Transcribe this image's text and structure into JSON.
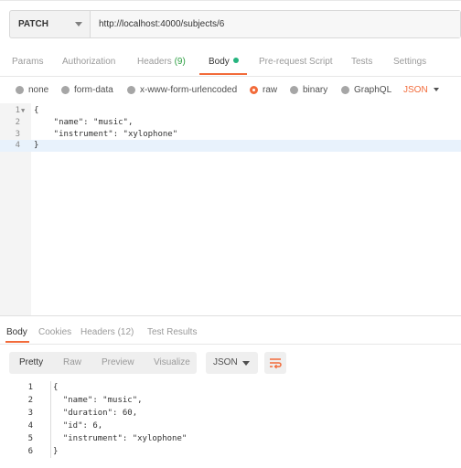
{
  "request": {
    "method": "PATCH",
    "url": "http://localhost:4000/subjects/6"
  },
  "request_tabs": [
    {
      "label": "Params",
      "count": "",
      "active": false
    },
    {
      "label": "Authorization",
      "count": "",
      "active": false
    },
    {
      "label": "Headers",
      "count": "(9)",
      "active": false
    },
    {
      "label": "Body",
      "count": "",
      "active": true
    },
    {
      "label": "Pre-request Script",
      "count": "",
      "active": false
    },
    {
      "label": "Tests",
      "count": "",
      "active": false
    },
    {
      "label": "Settings",
      "count": "",
      "active": false
    }
  ],
  "body_types": [
    {
      "label": "none",
      "selected": false
    },
    {
      "label": "form-data",
      "selected": false
    },
    {
      "label": "x-www-form-urlencoded",
      "selected": false
    },
    {
      "label": "raw",
      "selected": true
    },
    {
      "label": "binary",
      "selected": false
    },
    {
      "label": "GraphQL",
      "selected": false
    }
  ],
  "raw_format": "JSON",
  "request_body": {
    "line_numbers": [
      "1",
      "2",
      "3",
      "4"
    ],
    "lines": [
      "{",
      "    \"name\": \"music\",",
      "    \"instrument\": \"xylophone\"",
      "}"
    ]
  },
  "response_tabs": [
    {
      "label": "Body",
      "active": true
    },
    {
      "label": "Cookies",
      "active": false
    },
    {
      "label": "Headers (12)",
      "active": false
    },
    {
      "label": "Test Results",
      "active": false
    }
  ],
  "response_views": [
    {
      "label": "Pretty",
      "active": true
    },
    {
      "label": "Raw",
      "active": false
    },
    {
      "label": "Preview",
      "active": false
    },
    {
      "label": "Visualize",
      "active": false
    }
  ],
  "response_format": "JSON",
  "response_body": {
    "line_numbers": [
      "1",
      "2",
      "3",
      "4",
      "5",
      "6"
    ],
    "lines": [
      "{",
      "  \"name\": \"music\",",
      "  \"duration\": 60,",
      "  \"id\": 6,",
      "  \"instrument\": \"xylophone\"",
      "}"
    ]
  },
  "colors": {
    "accent": "#f26b3a",
    "body_dot": "#26b47f",
    "headers_count": "#2ea043"
  },
  "icons": {
    "method_dropdown": "chevron-down-icon",
    "format_dropdown": "chevron-down-icon",
    "wrap": "wrap-lines-icon",
    "fold": "fold-arrow-icon"
  }
}
